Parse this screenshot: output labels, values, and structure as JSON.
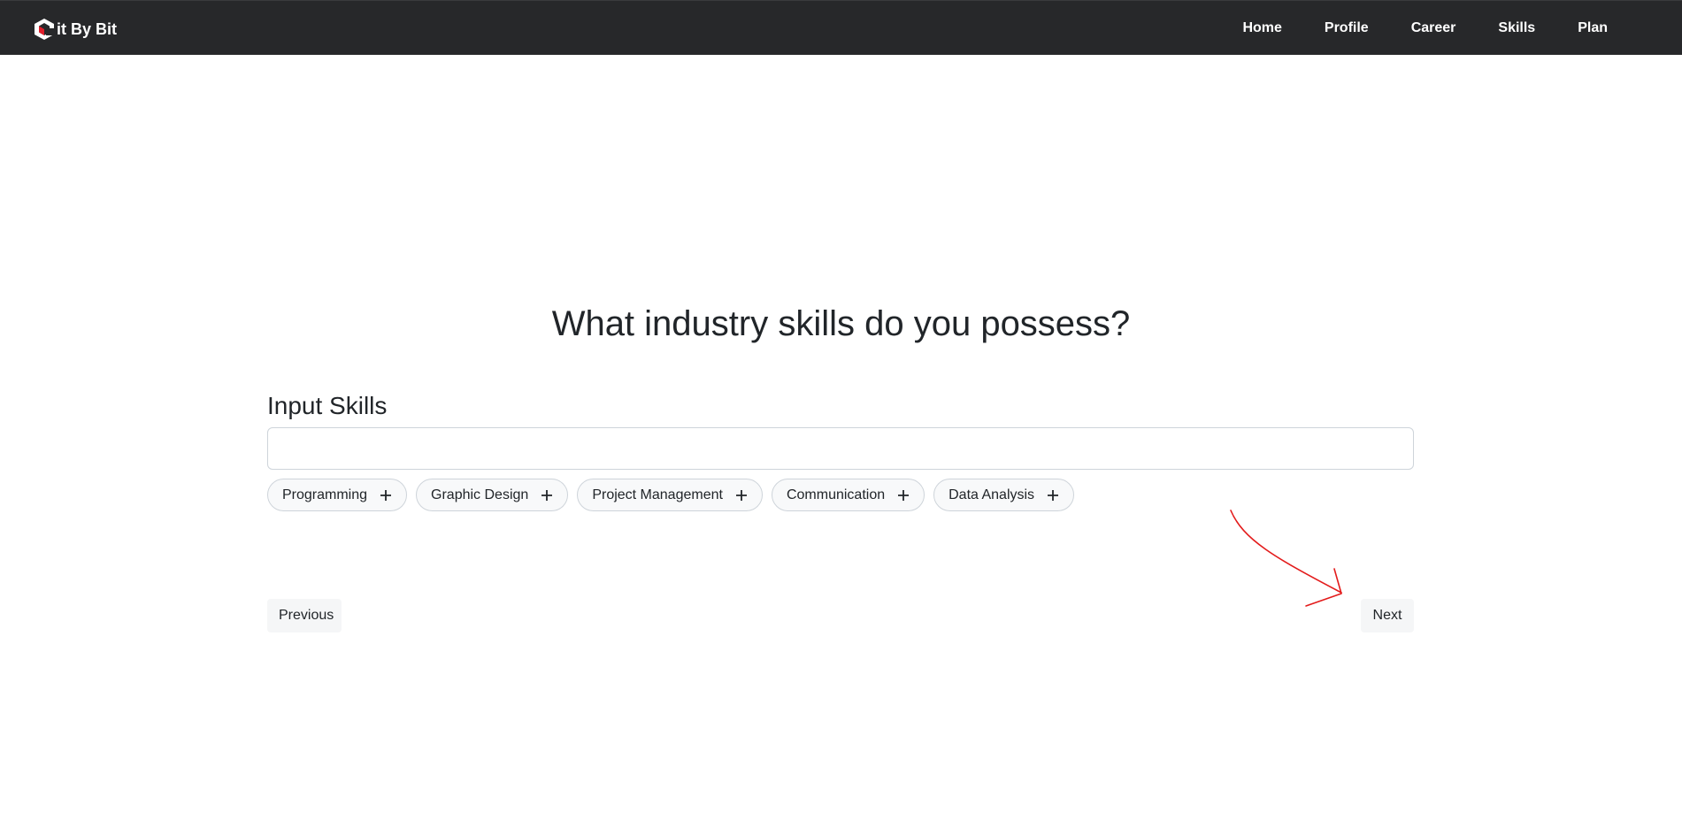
{
  "brand": {
    "logo_letter": "B",
    "name": "it By Bit"
  },
  "nav": {
    "items": [
      {
        "label": "Home"
      },
      {
        "label": "Profile"
      },
      {
        "label": "Career"
      },
      {
        "label": "Skills"
      },
      {
        "label": "Plan"
      }
    ]
  },
  "main": {
    "question": "What industry skills do you possess?",
    "input_label": "Input Skills",
    "input_value": "",
    "suggestions": [
      {
        "label": "Programming",
        "icon": "plus-icon"
      },
      {
        "label": "Graphic Design",
        "icon": "plus-icon"
      },
      {
        "label": "Project Management",
        "icon": "plus-icon"
      },
      {
        "label": "Communication",
        "icon": "plus-icon"
      },
      {
        "label": "Data Analysis",
        "icon": "plus-icon"
      }
    ]
  },
  "buttons": {
    "previous": "Previous",
    "next": "Next"
  },
  "colors": {
    "navbar": "#27282a",
    "logo_accent": "#e11d2a",
    "annotation_arrow": "#e31b1b",
    "button_bg": "#f5f6f7"
  }
}
